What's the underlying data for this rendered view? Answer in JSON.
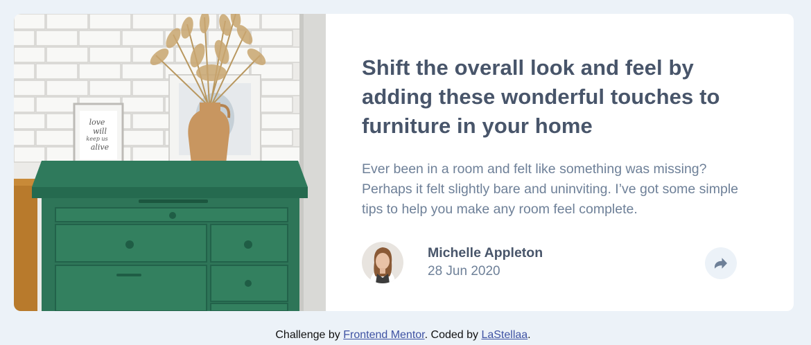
{
  "article": {
    "headline": "Shift the overall look and feel by adding these wonderful touches to furniture in your home",
    "description": "Ever been in a room and felt like something was missing? Perhaps it felt slightly bare and uninviting. I’ve got some simple tips to help you make any room feel complete.",
    "image_icon": "drawers-photo",
    "frame_text": [
      "love",
      "will",
      "keep us",
      "alive"
    ]
  },
  "author": {
    "name": "Michelle Appleton",
    "date": "28 Jun 2020",
    "avatar_icon": "avatar-photo"
  },
  "share": {
    "icon": "share-icon"
  },
  "attribution": {
    "prefix": "Challenge by ",
    "link1": "Frontend Mentor",
    "middle": ". Coded by ",
    "link2": "LaStellaa",
    "suffix": "."
  },
  "colors": {
    "background": "#ecf2f8",
    "card": "#ffffff",
    "heading": "#48556a",
    "body": "#6e8098",
    "link": "#3e52a3",
    "drawer_green": "#2f7a5c"
  }
}
